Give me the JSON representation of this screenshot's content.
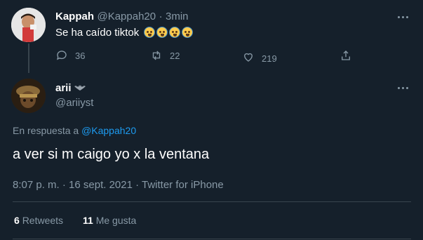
{
  "parent_tweet": {
    "author_name": "Kappah",
    "handle": "@Kappah20",
    "separator": "·",
    "time": "3min",
    "text": "Se ha caído tiktok",
    "emoji": [
      "loudly-crying-face",
      "loudly-crying-face",
      "loudly-crying-face",
      "loudly-crying-face"
    ],
    "replies": "36",
    "retweets": "22",
    "likes": "219"
  },
  "main_tweet": {
    "author_name": "arii",
    "handle": "@ariiyst",
    "reply_prefix": "En respuesta a",
    "reply_to": "@Kappah20",
    "text": "a ver si m caigo yo x la ventana",
    "meta": "8:07 p. m. · 16 sept. 2021 · Twitter for iPhone",
    "retweet_count": "6",
    "retweet_label": "Retweets",
    "like_count": "11",
    "like_label": "Me gusta"
  },
  "colors": {
    "background": "#15202b",
    "muted": "#8899a6",
    "link": "#1d9bf0",
    "divider": "#38444d"
  }
}
